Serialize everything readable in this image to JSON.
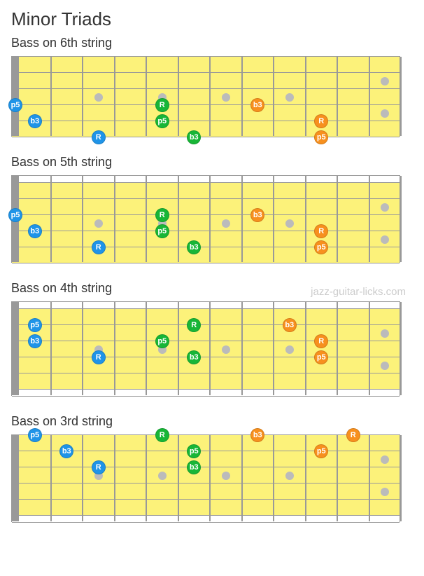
{
  "page_title": "Minor Triads",
  "watermark": "jazz-guitar-licks.com",
  "colors": {
    "blue": "#1f94e8",
    "green": "#18b637",
    "orange": "#f7901e"
  },
  "fretboard": {
    "num_frets": 12,
    "num_strings": 6,
    "inlay_frets_single": [
      3,
      5,
      7,
      9
    ],
    "inlay_frets_double": [
      12
    ]
  },
  "chart_data": [
    {
      "label": "Bass   on 6th string",
      "top_open": false,
      "bottom_open": false,
      "base_string": 6,
      "notes": [
        {
          "fret": 0,
          "string": 4,
          "label": "p5",
          "color": "blue"
        },
        {
          "fret": 1,
          "string": 5,
          "label": "b3",
          "color": "blue"
        },
        {
          "fret": 3,
          "string": 6,
          "label": "R",
          "color": "blue"
        },
        {
          "fret": 5,
          "string": 4,
          "label": "R",
          "color": "green"
        },
        {
          "fret": 5,
          "string": 5,
          "label": "p5",
          "color": "green"
        },
        {
          "fret": 6,
          "string": 6,
          "label": "b3",
          "color": "green"
        },
        {
          "fret": 8,
          "string": 4,
          "label": "b3",
          "color": "orange"
        },
        {
          "fret": 10,
          "string": 5,
          "label": "R",
          "color": "orange"
        },
        {
          "fret": 10,
          "string": 6,
          "label": "p5",
          "color": "orange"
        }
      ]
    },
    {
      "label": "Bass   on 5th string",
      "top_open": true,
      "bottom_open": false,
      "base_string": 5,
      "notes": [
        {
          "fret": 0,
          "string": 3,
          "label": "p5",
          "color": "blue"
        },
        {
          "fret": 1,
          "string": 4,
          "label": "b3",
          "color": "blue"
        },
        {
          "fret": 3,
          "string": 5,
          "label": "R",
          "color": "blue"
        },
        {
          "fret": 5,
          "string": 3,
          "label": "R",
          "color": "green"
        },
        {
          "fret": 5,
          "string": 4,
          "label": "p5",
          "color": "green"
        },
        {
          "fret": 6,
          "string": 5,
          "label": "b3",
          "color": "green"
        },
        {
          "fret": 8,
          "string": 3,
          "label": "b3",
          "color": "orange"
        },
        {
          "fret": 10,
          "string": 4,
          "label": "R",
          "color": "orange"
        },
        {
          "fret": 10,
          "string": 5,
          "label": "p5",
          "color": "orange"
        }
      ]
    },
    {
      "label": "Bass   on 4th string",
      "top_open": true,
      "bottom_open": true,
      "base_string": 4,
      "notes": [
        {
          "fret": 1,
          "string": 2,
          "label": "p5",
          "color": "blue"
        },
        {
          "fret": 1,
          "string": 3,
          "label": "b3",
          "color": "blue"
        },
        {
          "fret": 3,
          "string": 4,
          "label": "R",
          "color": "blue"
        },
        {
          "fret": 6,
          "string": 2,
          "label": "R",
          "color": "green"
        },
        {
          "fret": 5,
          "string": 3,
          "label": "p5",
          "color": "green"
        },
        {
          "fret": 6,
          "string": 4,
          "label": "b3",
          "color": "green"
        },
        {
          "fret": 9,
          "string": 2,
          "label": "b3",
          "color": "orange"
        },
        {
          "fret": 10,
          "string": 3,
          "label": "R",
          "color": "orange"
        },
        {
          "fret": 10,
          "string": 4,
          "label": "p5",
          "color": "orange"
        }
      ]
    },
    {
      "label": "Bass   on 3rd string",
      "top_open": false,
      "bottom_open": true,
      "base_string": 3,
      "notes": [
        {
          "fret": 1,
          "string": 1,
          "label": "p5",
          "color": "blue"
        },
        {
          "fret": 2,
          "string": 2,
          "label": "b3",
          "color": "blue"
        },
        {
          "fret": 3,
          "string": 3,
          "label": "R",
          "color": "blue"
        },
        {
          "fret": 5,
          "string": 1,
          "label": "R",
          "color": "green"
        },
        {
          "fret": 6,
          "string": 2,
          "label": "p5",
          "color": "green"
        },
        {
          "fret": 6,
          "string": 3,
          "label": "b3",
          "color": "green"
        },
        {
          "fret": 8,
          "string": 1,
          "label": "b3",
          "color": "orange"
        },
        {
          "fret": 11,
          "string": 1,
          "label": "R",
          "color": "orange"
        },
        {
          "fret": 10,
          "string": 2,
          "label": "p5",
          "color": "orange"
        }
      ]
    }
  ]
}
